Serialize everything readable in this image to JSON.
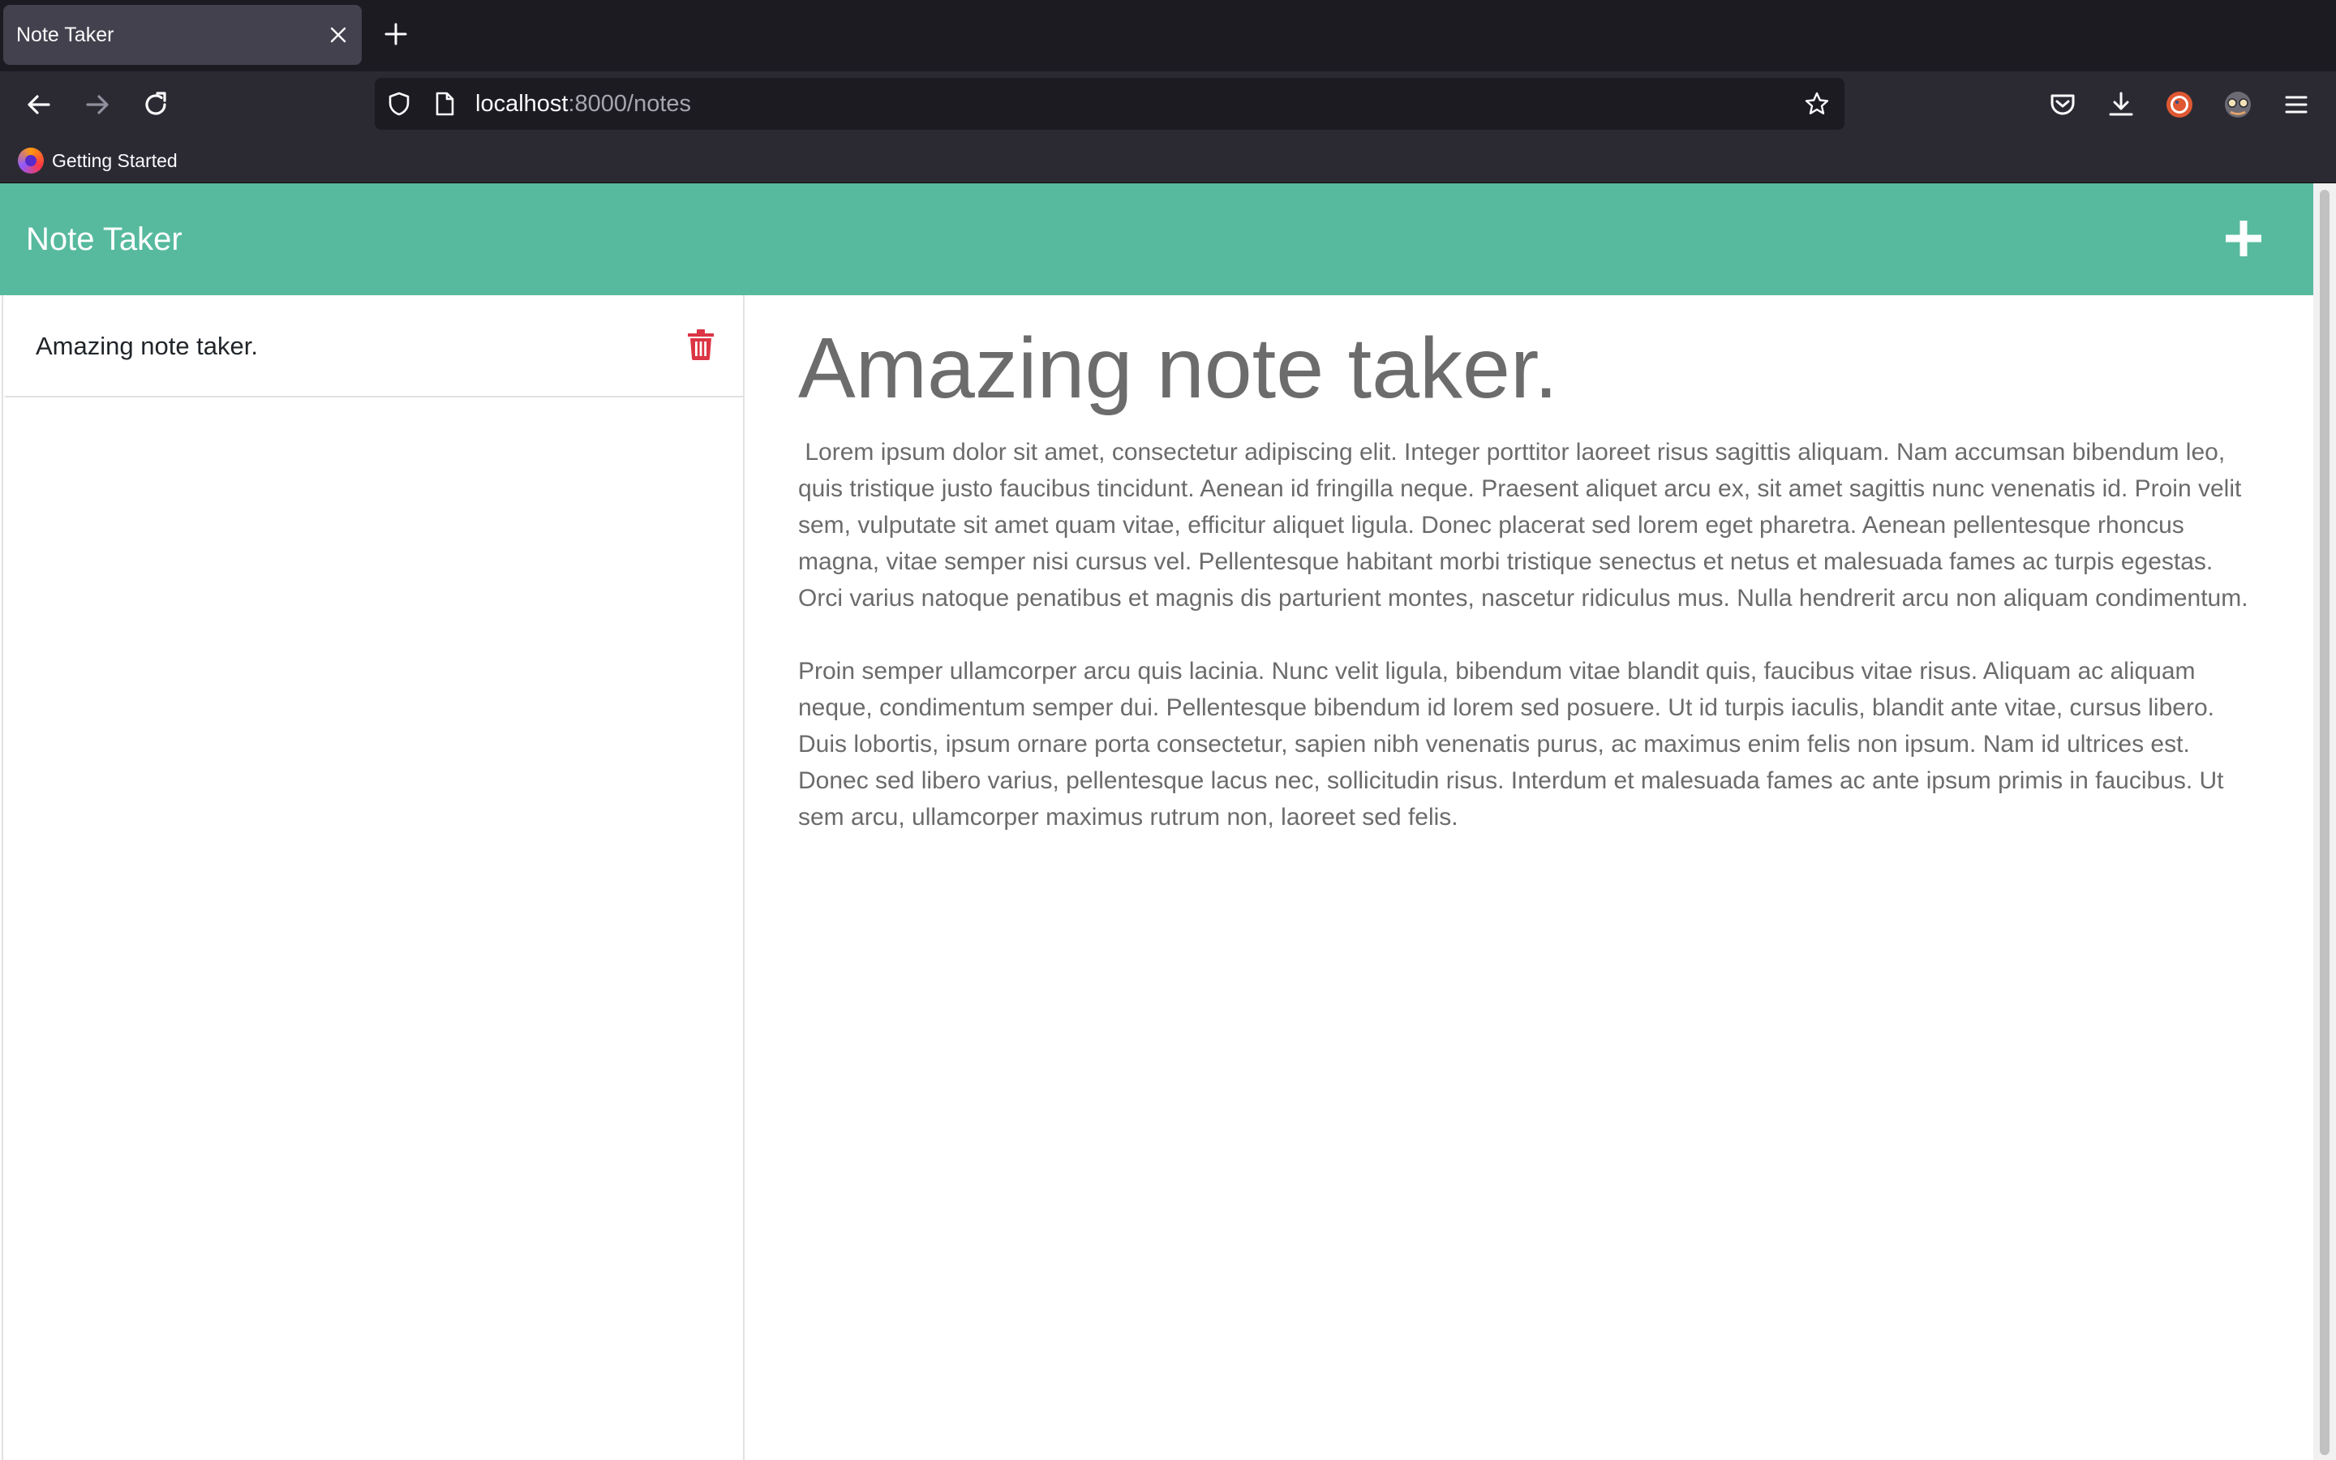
{
  "browser": {
    "tab_title": "Note Taker",
    "url_host": "localhost",
    "url_rest": ":8000/notes",
    "bookmark": "Getting Started"
  },
  "app": {
    "title": "Note Taker",
    "brand_color": "#57ba9e",
    "delete_color": "#dc3545"
  },
  "notes": [
    {
      "title": "Amazing note taker."
    }
  ],
  "active_note": {
    "title": "Amazing note taker.",
    "body": " Lorem ipsum dolor sit amet, consectetur adipiscing elit. Integer porttitor laoreet risus sagittis aliquam. Nam accumsan bibendum leo, quis tristique justo faucibus tincidunt. Aenean id fringilla neque. Praesent aliquet arcu ex, sit amet sagittis nunc venenatis id. Proin velit sem, vulputate sit amet quam vitae, efficitur aliquet ligula. Donec placerat sed lorem eget pharetra. Aenean pellentesque rhoncus magna, vitae semper nisi cursus vel. Pellentesque habitant morbi tristique senectus et netus et malesuada fames ac turpis egestas. Orci varius natoque penatibus et magnis dis parturient montes, nascetur ridiculus mus. Nulla hendrerit arcu non aliquam condimentum.\n\nProin semper ullamcorper arcu quis lacinia. Nunc velit ligula, bibendum vitae blandit quis, faucibus vitae risus. Aliquam ac aliquam neque, condimentum semper dui. Pellentesque bibendum id lorem sed posuere. Ut id turpis iaculis, blandit ante vitae, cursus libero. Duis lobortis, ipsum ornare porta consectetur, sapien nibh venenatis purus, ac maximus enim felis non ipsum. Nam id ultrices est. Donec sed libero varius, pellentesque lacus nec, sollicitudin risus. Interdum et malesuada fames ac ante ipsum primis in faucibus. Ut sem arcu, ullamcorper maximus rutrum non, laoreet sed felis."
  },
  "icons": {
    "tab_close": "close-icon",
    "new_tab": "plus-icon",
    "back": "arrow-left-icon",
    "forward": "arrow-right-icon",
    "reload": "reload-icon",
    "shield": "shield-icon",
    "page": "page-icon",
    "bookmark_star": "star-icon",
    "pocket": "pocket-icon",
    "downloads": "download-icon",
    "extension": "duckduckgo-icon",
    "account": "avatar-icon",
    "menu": "hamburger-menu-icon",
    "add_note": "plus-icon",
    "delete_note": "trash-icon"
  }
}
